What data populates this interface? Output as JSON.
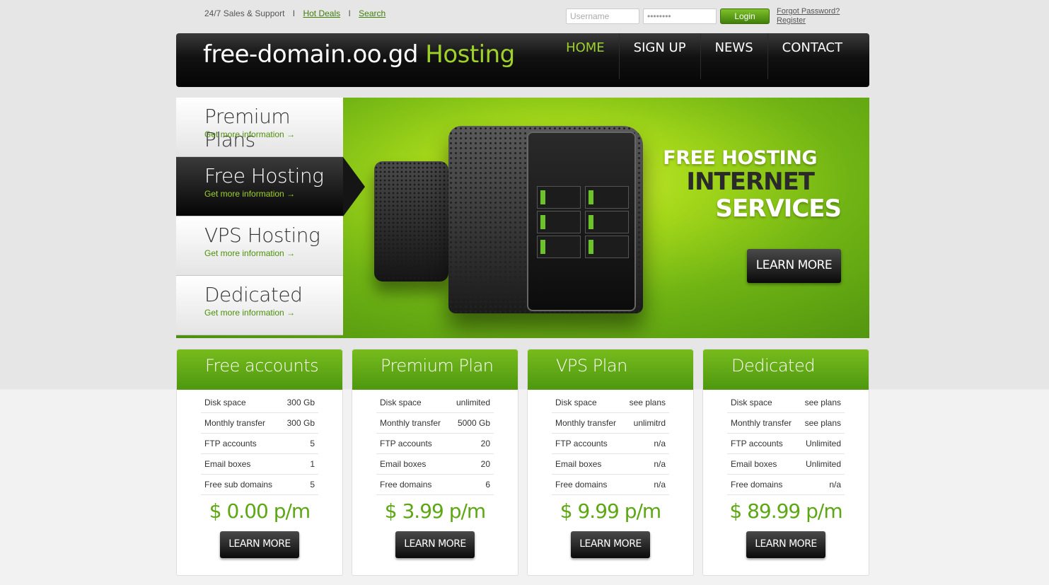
{
  "topbar": {
    "support": "24/7 Sales & Support",
    "sep": "I",
    "hot_deals": "Hot Deals",
    "search": "Search"
  },
  "login": {
    "username_placeholder": "Username",
    "password_value": "••••••••",
    "button": "Login",
    "forgot": "Forgot Password?",
    "register": "Register"
  },
  "header": {
    "logo_main": "free-domain.oo.gd",
    "logo_accent": "Hosting",
    "nav": [
      "HOME",
      "SIGN UP",
      "NEWS",
      "CONTACT"
    ]
  },
  "banner": {
    "tabs": [
      {
        "title": "Premium Plans",
        "more": "Get more information"
      },
      {
        "title": "Free Hosting",
        "more": "Get more information"
      },
      {
        "title": "VPS Hosting",
        "more": "Get more information"
      },
      {
        "title": "Dedicated",
        "more": "Get more information"
      }
    ],
    "arrow_glyph": "→",
    "promo_line1": "FREE HOSTING",
    "promo_line2": "INTERNET",
    "promo_line3": "SERVICES",
    "button": "LEARN MORE"
  },
  "plans": [
    {
      "title": "Free accounts",
      "rows": [
        [
          "Disk space",
          "300 Gb"
        ],
        [
          "Monthly transfer",
          "300 Gb"
        ],
        [
          "FTP accounts",
          "5"
        ],
        [
          "Email boxes",
          "1"
        ],
        [
          "Free sub domains",
          "5"
        ]
      ],
      "price": "$ 0.00 p/m",
      "button": "LEARN MORE"
    },
    {
      "title": "Premium Plan",
      "rows": [
        [
          "Disk space",
          "unlimited"
        ],
        [
          "Monthly transfer",
          "5000 Gb"
        ],
        [
          "FTP accounts",
          "20"
        ],
        [
          "Email boxes",
          "20"
        ],
        [
          "Free domains",
          "6"
        ]
      ],
      "price": "$ 3.99 p/m",
      "button": "LEARN MORE"
    },
    {
      "title": "VPS Plan",
      "rows": [
        [
          "Disk space",
          "see plans"
        ],
        [
          "Monthly transfer",
          "unlimitrd"
        ],
        [
          "FTP accounts",
          "n/a"
        ],
        [
          "Email boxes",
          "n/a"
        ],
        [
          "Free domains",
          "n/a"
        ]
      ],
      "price": "$ 9.99 p/m",
      "button": "LEARN MORE"
    },
    {
      "title": "Dedicated",
      "rows": [
        [
          "Disk space",
          "see plans"
        ],
        [
          "Monthly transfer",
          "see plans"
        ],
        [
          "FTP accounts",
          "Unlimited"
        ],
        [
          "Email boxes",
          "Unlimited"
        ],
        [
          "Free domains",
          "n/a"
        ]
      ],
      "price": "$ 89.99 p/m",
      "button": "LEARN MORE"
    }
  ],
  "colors": {
    "accent_green": "#9ed22a",
    "link_green": "#3f7f05",
    "price_green": "#5ea714"
  }
}
